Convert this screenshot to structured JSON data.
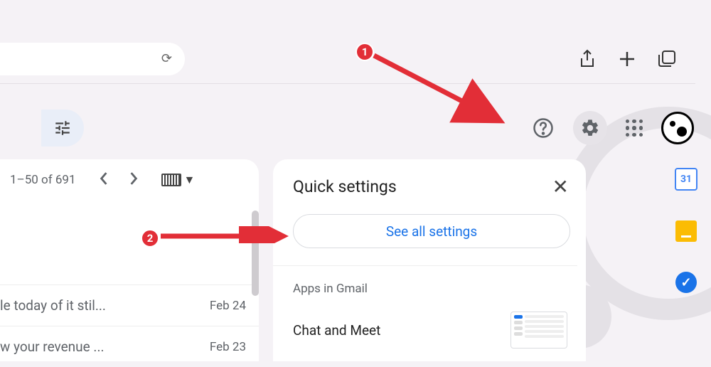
{
  "browser": {
    "refresh_glyph": "⟳"
  },
  "toolbar": {
    "help_label": "Help",
    "settings_label": "Settings",
    "apps_label": "Google apps"
  },
  "inbox": {
    "pager": "1–50 of 691",
    "emails": [
      {
        "subject": "le today of it stil...",
        "date": "Feb 24"
      },
      {
        "subject": "w your revenue ...",
        "date": "Feb 23"
      }
    ]
  },
  "settings": {
    "title": "Quick settings",
    "see_all": "See all settings",
    "apps_section": "Apps in Gmail",
    "chat_meet": "Chat and Meet"
  },
  "sidebar": {
    "calendar_day": "31"
  },
  "annotations": {
    "step1": "1",
    "step2": "2"
  }
}
